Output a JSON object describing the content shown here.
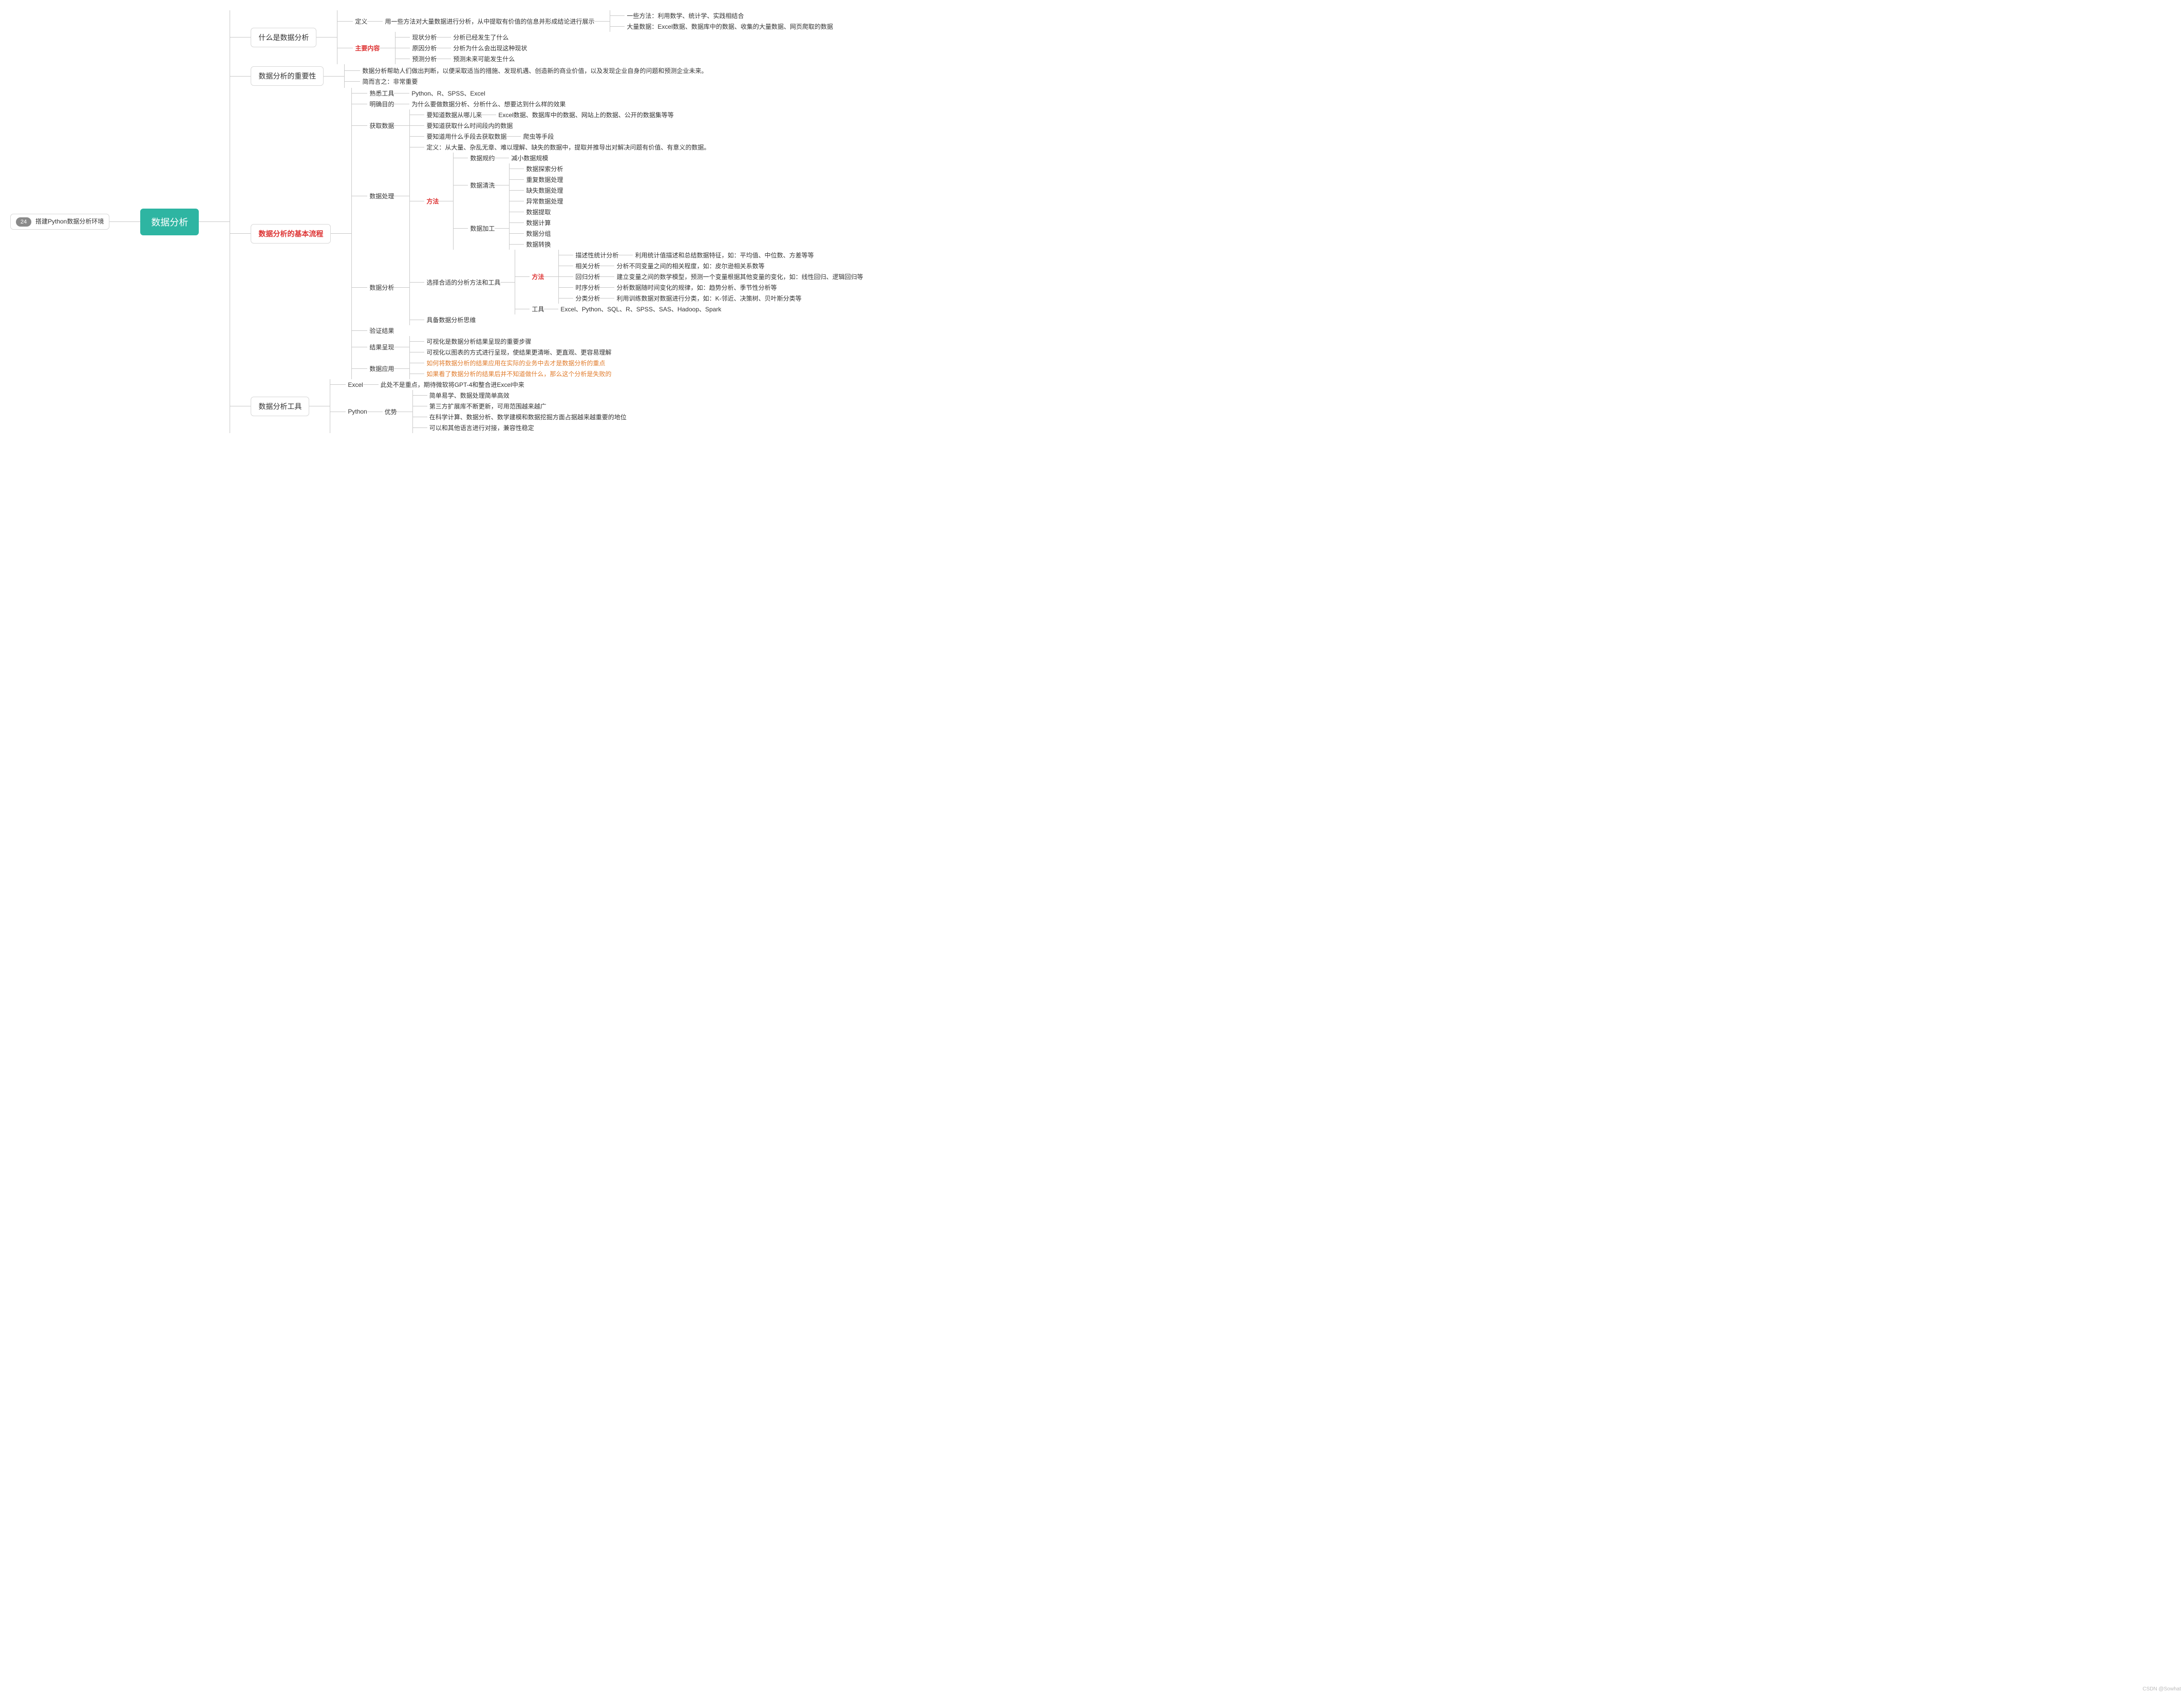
{
  "left": {
    "badge": "24",
    "link": "搭建Python数据分析环境"
  },
  "root": "数据分析",
  "b1": {
    "label": "什么是数据分析",
    "def": {
      "k": "定义",
      "v": "用一些方法对大量数据进行分析，从中提取有价值的信息并形成结论进行展示",
      "sub": [
        "一些方法：利用数学、统计学、实践相结合",
        "大量数据：Excel数据、数据库中的数据、收集的大量数据、网页爬取的数据"
      ]
    },
    "main": {
      "k": "主要内容",
      "items": [
        {
          "k": "现状分析",
          "v": "分析已经发生了什么"
        },
        {
          "k": "原因分析",
          "v": "分析为什么会出现这种现状"
        },
        {
          "k": "预测分析",
          "v": "预测未来可能发生什么"
        }
      ]
    }
  },
  "b2": {
    "label": "数据分析的重要性",
    "lines": [
      "数据分析帮助人们做出判断，以便采取适当的措施、发现机遇、创造新的商业价值，以及发现企业自身的问题和预测企业未来。",
      "简而言之：非常重要"
    ]
  },
  "b3": {
    "label": "数据分析的基本流程",
    "s1": {
      "k": "熟悉工具",
      "v": "Python、R、SPSS、Excel"
    },
    "s2": {
      "k": "明确目的",
      "v": "为什么要做数据分析、分析什么、想要达到什么样的效果"
    },
    "s3": {
      "k": "获取数据",
      "items": [
        {
          "k": "要知道数据从哪儿来",
          "v": "Excel数据、数据库中的数据、网站上的数据、公开的数据集等等"
        },
        {
          "k": "要知道获取什么时间段内的数据",
          "v": ""
        },
        {
          "k": "要知道用什么手段去获取数据",
          "v": "爬虫等手段"
        }
      ]
    },
    "s4": {
      "k": "数据处理",
      "def": "定义：从大量、杂乱无章、难以理解、缺失的数据中，提取并推导出对解决问题有价值、有意义的数据。",
      "method": {
        "k": "方法",
        "r": {
          "k": "数据规约",
          "v": "减小数据规模"
        },
        "c": {
          "k": "数据清洗",
          "items": [
            "数据探索分析",
            "重复数据处理",
            "缺失数据处理",
            "异常数据处理"
          ]
        },
        "p": {
          "k": "数据加工",
          "items": [
            "数据提取",
            "数据计算",
            "数据分组",
            "数据转换"
          ]
        }
      }
    },
    "s5": {
      "k": "数据分析",
      "sel": {
        "k": "选择合适的分析方法和工具",
        "m": {
          "k": "方法",
          "items": [
            {
              "k": "描述性统计分析",
              "v": "利用统计值描述和总结数据特征，如：平均值、中位数、方差等等"
            },
            {
              "k": "相关分析",
              "v": "分析不同变量之间的相关程度，如：皮尔逊相关系数等"
            },
            {
              "k": "回归分析",
              "v": "建立变量之间的数学模型，预测一个变量根据其他变量的变化，如：线性回归、逻辑回归等"
            },
            {
              "k": "时序分析",
              "v": "分析数据随时间变化的规律，如：趋势分析、季节性分析等"
            },
            {
              "k": "分类分析",
              "v": "利用训练数据对数据进行分类，如：K-邻近、决策树、贝叶斯分类等"
            }
          ]
        },
        "t": {
          "k": "工具",
          "v": "Excel、Python、SQL、R、SPSS、SAS、Hadoop、Spark"
        }
      },
      "th": {
        "k": "具备数据分析思维"
      }
    },
    "s6": {
      "k": "验证结果"
    },
    "s7": {
      "k": "结果呈现",
      "items": [
        "可视化是数据分析结果呈现的重要步骤",
        "可视化以图表的方式进行呈现，使结果更清晰、更直观、更容易理解"
      ]
    },
    "s8": {
      "k": "数据应用",
      "items": [
        "如何将数据分析的结果应用在实际的业务中去才是数据分析的重点",
        "如果看了数据分析的结果后并不知道做什么，那么这个分析是失败的"
      ]
    }
  },
  "b4": {
    "label": "数据分析工具",
    "excel": {
      "k": "Excel",
      "v": "此处不是重点，期待微软将GPT-4和整合进Excel中来"
    },
    "py": {
      "k": "Python",
      "adv": {
        "k": "优势",
        "items": [
          "简单易学、数据处理简单高效",
          "第三方扩展库不断更新，可用范围越来越广",
          "在科学计算、数据分析、数学建模和数据挖掘方面占据越来越重要的地位",
          "可以和其他语言进行对接，兼容性稳定"
        ]
      }
    }
  },
  "watermark": "CSDN @Sowhat"
}
